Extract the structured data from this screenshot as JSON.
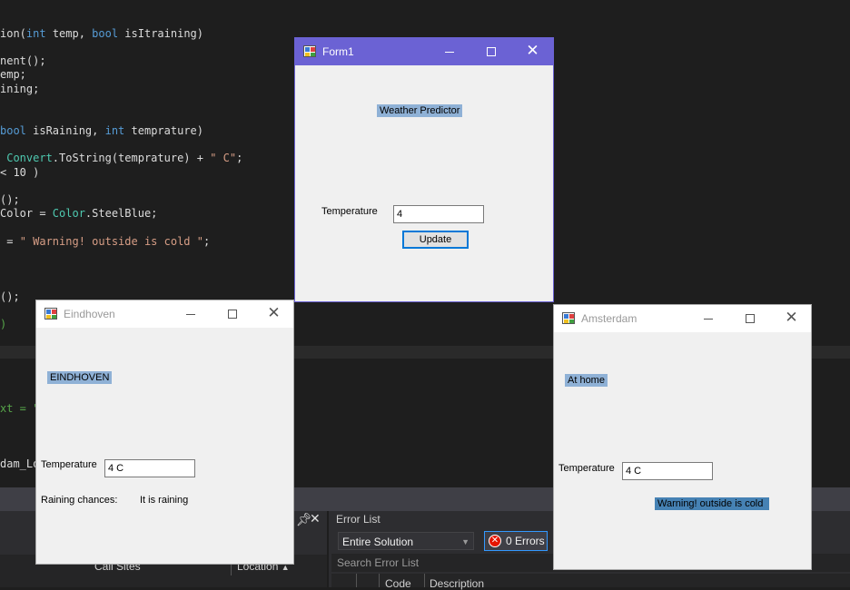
{
  "code": {
    "lines": [
      {
        "parts": [
          {
            "t": "ion(",
            "c": ""
          },
          {
            "t": "int",
            "c": "kw"
          },
          {
            "t": " temp, ",
            "c": ""
          },
          {
            "t": "bool",
            "c": "kw"
          },
          {
            "t": " isItraining)",
            "c": ""
          }
        ]
      },
      {
        "parts": [
          {
            "t": "nent();",
            "c": ""
          }
        ]
      },
      {
        "parts": [
          {
            "t": "emp;",
            "c": ""
          }
        ]
      },
      {
        "parts": [
          {
            "t": "ining;",
            "c": ""
          }
        ]
      },
      {
        "parts": [
          {
            "t": "bool",
            "c": "kw"
          },
          {
            "t": " isRaining, ",
            "c": ""
          },
          {
            "t": "int",
            "c": "kw"
          },
          {
            "t": " temprature)",
            "c": ""
          }
        ]
      },
      {
        "parts": [
          {
            "t": " Convert",
            "c": "ty"
          },
          {
            "t": ".ToString(temprature) + ",
            "c": ""
          },
          {
            "t": "\" C\"",
            "c": "str"
          },
          {
            "t": ";",
            "c": ""
          }
        ]
      },
      {
        "parts": [
          {
            "t": "< 10 )",
            "c": ""
          }
        ]
      },
      {
        "parts": [
          {
            "t": "();",
            "c": ""
          }
        ]
      },
      {
        "parts": [
          {
            "t": "Color = ",
            "c": ""
          },
          {
            "t": "Color",
            "c": "ty"
          },
          {
            "t": ".SteelBlue;",
            "c": ""
          }
        ]
      },
      {
        "parts": [
          {
            "t": " = ",
            "c": ""
          },
          {
            "t": "\" Warning! outside is cold \"",
            "c": "str"
          },
          {
            "t": ";",
            "c": ""
          }
        ]
      },
      {
        "parts": [
          {
            "t": "();",
            "c": ""
          }
        ]
      },
      {
        "parts": [
          {
            "t": ")",
            "c": "cm"
          }
        ]
      },
      {
        "parts": [
          {
            "t": "xt = \"",
            "c": "cm"
          }
        ]
      },
      {
        "parts": [
          {
            "t": "xt = \"",
            "c": "cm"
          }
        ]
      },
      {
        "parts": [
          {
            "t": "dam_Lo",
            "c": ""
          }
        ]
      }
    ]
  },
  "bottom_panel": {
    "call_sites_header": "Call Sites",
    "location_header": "Location",
    "error_list_title": "Error List",
    "scope_select": "Entire Solution",
    "errors_button": "0 Errors",
    "search_placeholder": "Search Error List",
    "col_code": "Code",
    "col_description": "Description"
  },
  "form1": {
    "title": "Form1",
    "heading": "Weather Predictor",
    "temperature_label": "Temperature",
    "temperature_value": "4",
    "update_button": "Update"
  },
  "eindhoven": {
    "title": "Eindhoven",
    "city_label": "EINDHOVEN",
    "temperature_label": "Temperature",
    "temperature_value": "4 C",
    "raining_label": "Raining chances:",
    "raining_value": "It is raining"
  },
  "amsterdam": {
    "title": "Amsterdam",
    "status_label": "At home",
    "temperature_label": "Temperature",
    "temperature_value": "4 C",
    "warning": "Warning! outside is cold"
  },
  "colors": {
    "active_titlebar": "#6b62d4",
    "label_highlight": "#8fb1d6",
    "steel_blue": "#4682b4",
    "error_red": "#e51400"
  }
}
